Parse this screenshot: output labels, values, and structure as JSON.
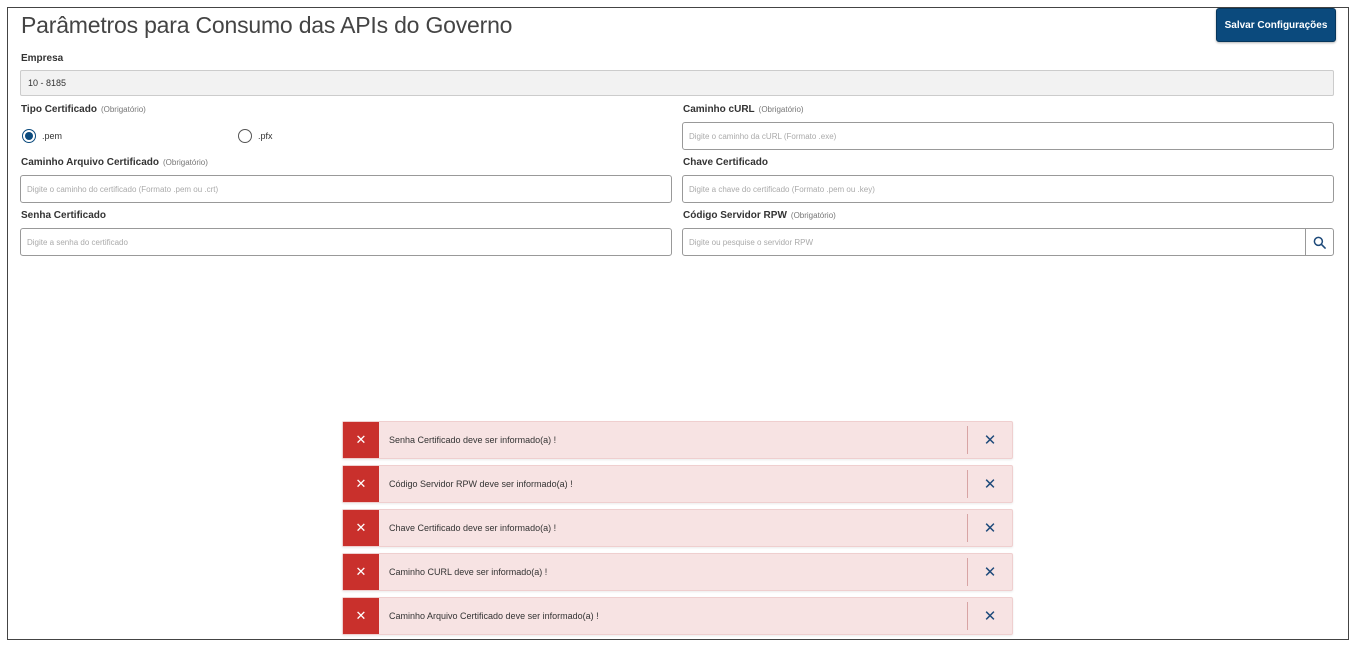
{
  "page": {
    "title": "Parâmetros para Consumo das APIs do Governo",
    "save_label": "Salvar Configurações"
  },
  "empresa": {
    "label": "Empresa",
    "value": "10 - 8185"
  },
  "tipo_certificado": {
    "label": "Tipo Certificado",
    "required": "(Obrigatório)",
    "options": [
      {
        "label": ".pem",
        "selected": true
      },
      {
        "label": ".pfx",
        "selected": false
      }
    ]
  },
  "caminho_curl": {
    "label": "Caminho cURL",
    "required": "(Obrigatório)",
    "placeholder": "Digite o caminho da cURL (Formato .exe)"
  },
  "caminho_certificado": {
    "label": "Caminho Arquivo Certificado",
    "required": "(Obrigatório)",
    "placeholder": "Digite o caminho do certificado (Formato .pem ou .crt)"
  },
  "chave_certificado": {
    "label": "Chave Certificado",
    "placeholder": "Digite a chave do certificado (Formato .pem ou .key)"
  },
  "senha_certificado": {
    "label": "Senha Certificado",
    "placeholder": "Digite a senha do certificado"
  },
  "servidor_rpw": {
    "label": "Código Servidor RPW",
    "required": "(Obrigatório)",
    "placeholder": "Digite ou pesquise o servidor RPW"
  },
  "toasts": [
    {
      "message": "Senha Certificado deve ser informado(a) !"
    },
    {
      "message": "Código Servidor RPW deve ser informado(a) !"
    },
    {
      "message": "Chave Certificado deve ser informado(a) !"
    },
    {
      "message": "Caminho CURL deve ser informado(a) !"
    },
    {
      "message": "Caminho Arquivo Certificado deve ser informado(a) !"
    }
  ],
  "colors": {
    "primary": "#0b4a7d",
    "error": "#c9302c",
    "toast_bg": "#f7e3e3"
  }
}
